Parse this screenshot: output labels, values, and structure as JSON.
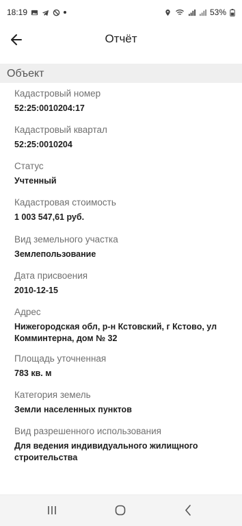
{
  "status": {
    "time": "18:19",
    "battery": "53%"
  },
  "app": {
    "title": "Отчёт"
  },
  "section": {
    "title": "Объект"
  },
  "fields": [
    {
      "label": "Кадастровый номер",
      "value": "52:25:0010204:17"
    },
    {
      "label": "Кадастровый квартал",
      "value": "52:25:0010204"
    },
    {
      "label": "Статус",
      "value": "Учтенный"
    },
    {
      "label": "Кадастровая стоимость",
      "value": "1 003 547,61 руб."
    },
    {
      "label": "Вид земельного участка",
      "value": "Землепользование"
    },
    {
      "label": "Дата присвоения",
      "value": "2010-12-15"
    },
    {
      "label": "Адрес",
      "value": "Нижегородская обл, р-н Кстовский, г Кстово, ул Комминтерна, дом № 32"
    },
    {
      "label": "Площадь уточненная",
      "value": "783 кв. м"
    },
    {
      "label": "Категория земель",
      "value": "Земли населенных пунктов"
    },
    {
      "label": "Вид разрешенного использования",
      "value": "Для ведения индивидуального жилищного строительства"
    }
  ],
  "icons": {
    "back": "back-arrow-icon",
    "recents": "recent-apps-icon",
    "home": "home-icon",
    "nav_back": "nav-back-icon"
  }
}
